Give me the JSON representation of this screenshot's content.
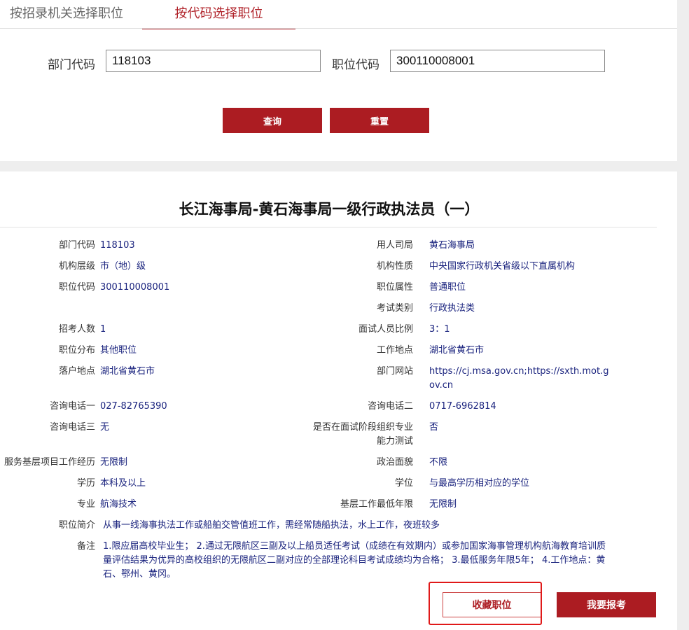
{
  "tabs": {
    "by_agency": "按招录机关选择职位",
    "by_code": "按代码选择职位"
  },
  "search": {
    "dept_code_label": "部门代码",
    "dept_code_value": "118103",
    "position_code_label": "职位代码",
    "position_code_value": "300110008001",
    "query_button": "查询",
    "reset_button": "重置"
  },
  "detail": {
    "title": "长江海事局-黄石海事局一级行政执法员（一）",
    "fields": {
      "dept_code": {
        "label": "部门代码",
        "value": "118103"
      },
      "employer": {
        "label": "用人司局",
        "value": "黄石海事局"
      },
      "org_level": {
        "label": "机构层级",
        "value": "市（地）级"
      },
      "org_nature": {
        "label": "机构性质",
        "value": "中央国家行政机关省级以下直属机构"
      },
      "position_code": {
        "label": "职位代码",
        "value": "300110008001"
      },
      "position_attr": {
        "label": "职位属性",
        "value": "普通职位"
      },
      "exam_category": {
        "label": "考试类别",
        "value": "行政执法类"
      },
      "recruit_count": {
        "label": "招考人数",
        "value": "1"
      },
      "interview_ratio": {
        "label": "面试人员比例",
        "value": "3：1"
      },
      "distribution": {
        "label": "职位分布",
        "value": "其他职位"
      },
      "work_location": {
        "label": "工作地点",
        "value": "湖北省黄石市"
      },
      "settle_location": {
        "label": "落户地点",
        "value": "湖北省黄石市"
      },
      "dept_website": {
        "label": "部门网站",
        "value": "https://cj.msa.gov.cn;https://sxth.mot.gov.cn"
      },
      "phone1": {
        "label": "咨询电话一",
        "value": "027-82765390"
      },
      "phone2": {
        "label": "咨询电话二",
        "value": "0717-6962814"
      },
      "phone3": {
        "label": "咨询电话三",
        "value": "无"
      },
      "special_test": {
        "label": "是否在面试阶段组织专业能力测试",
        "value": "否"
      },
      "grassroots_project": {
        "label": "服务基层项目工作经历",
        "value": "无限制"
      },
      "political_status": {
        "label": "政治面貌",
        "value": "不限"
      },
      "education": {
        "label": "学历",
        "value": "本科及以上"
      },
      "degree": {
        "label": "学位",
        "value": "与最高学历相对应的学位"
      },
      "major": {
        "label": "专业",
        "value": "航海技术"
      },
      "grassroots_years": {
        "label": "基层工作最低年限",
        "value": "无限制"
      },
      "position_intro": {
        "label": "职位简介",
        "value": "从事一线海事执法工作或船舶交管值班工作，需经常随船执法，水上工作，夜班较多"
      },
      "remarks": {
        "label": "备注",
        "value": "1.限应届高校毕业生； 2.通过无限航区三副及以上船员适任考试（成绩在有效期内）或参加国家海事管理机构航海教育培训质量评估结果为优异的高校组织的无限航区二副对应的全部理论科目考试成绩均为合格； 3.最低服务年限5年； 4.工作地点：黄石、鄂州、黄冈。"
      }
    },
    "favorite_button": "收藏职位",
    "apply_button": "我要报考"
  },
  "colors": {
    "accent": "#ac1c22",
    "value_text": "#1a237e",
    "highlight": "#e01919"
  }
}
